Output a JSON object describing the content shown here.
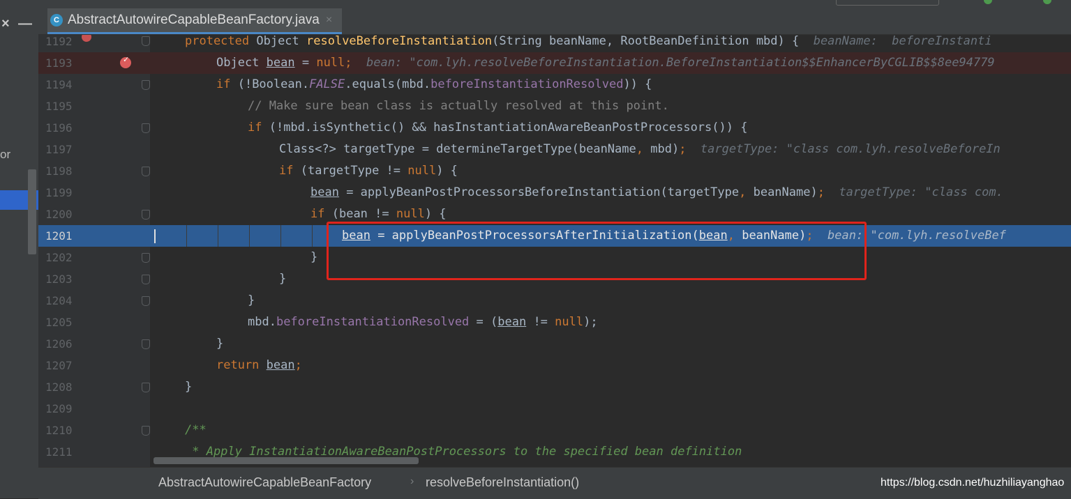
{
  "tab": {
    "icon_letter": "C",
    "filename": "AbstractAutowireCapableBeanFactory.java",
    "close": "×"
  },
  "left_panel": {
    "close_glyph": "×",
    "minimize_glyph": "—",
    "truncated_label": "or"
  },
  "breadcrumb": {
    "class_name": "AbstractAutowireCapableBeanFactory",
    "separator": "›",
    "method_name": "resolveBeforeInstantiation()"
  },
  "watermark": "https://blog.csdn.net/huzhiliayanghao",
  "editor": {
    "current_line": 1201,
    "breakpoint_line": 1193,
    "lines": [
      {
        "num": "1192"
      },
      {
        "num": "1193"
      },
      {
        "num": "1194"
      },
      {
        "num": "1195"
      },
      {
        "num": "1196"
      },
      {
        "num": "1197"
      },
      {
        "num": "1198"
      },
      {
        "num": "1199"
      },
      {
        "num": "1200"
      },
      {
        "num": "1201"
      },
      {
        "num": "1202"
      },
      {
        "num": "1203"
      },
      {
        "num": "1204"
      },
      {
        "num": "1205"
      },
      {
        "num": "1206"
      },
      {
        "num": "1207"
      },
      {
        "num": "1208"
      },
      {
        "num": "1209"
      },
      {
        "num": "1210"
      },
      {
        "num": "1211"
      }
    ],
    "t": {
      "l1192_a": "protected ",
      "l1192_b": "Object ",
      "l1192_c": "resolveBeforeInstantiation",
      "l1192_d": "(String beanName, RootBeanDefinition mbd) {  ",
      "l1192_hint": "beanName:  beforeInstanti",
      "l1193_a": "Object ",
      "l1193_b": "bean",
      "l1193_c": " = ",
      "l1193_d": "null",
      "l1193_e": ";  ",
      "l1193_hint": "bean: \"com.lyh.resolveBeforeInstantiation.BeforeInstantiation$$EnhancerByCGLIB$$8ee94779",
      "l1194_a": "if ",
      "l1194_b": "(!Boolean.",
      "l1194_c": "FALSE",
      "l1194_d": ".equals(mbd.",
      "l1194_e": "beforeInstantiationResolved",
      "l1194_f": ")) {",
      "l1195": "// Make sure bean class is actually resolved at this point.",
      "l1196_a": "if ",
      "l1196_b": "(!mbd.isSynthetic() && hasInstantiationAwareBeanPostProcessors()) {",
      "l1197_a": "Class<?> targetType = determineTargetType(beanName",
      "l1197_b": ", ",
      "l1197_c": "mbd)",
      "l1197_d": ";  ",
      "l1197_hint": "targetType: \"class com.lyh.resolveBeforeIn",
      "l1198_a": "if ",
      "l1198_b": "(targetType != ",
      "l1198_c": "null",
      "l1198_d": ") {",
      "l1199_a": "bean",
      "l1199_b": " = applyBeanPostProcessorsBeforeInstantiation(targetType",
      "l1199_c": ", ",
      "l1199_d": "beanName)",
      "l1199_e": ";  ",
      "l1199_hint": "targetType: \"class com.",
      "l1200_a": "if ",
      "l1200_b": "(",
      "l1200_c": "bean",
      "l1200_d": " != ",
      "l1200_e": "null",
      "l1200_f": ") {",
      "l1201_a": "bean",
      "l1201_b": " = applyBeanPostProcessorsAfterInitialization(",
      "l1201_c": "bean",
      "l1201_d": ", ",
      "l1201_e": "beanName)",
      "l1201_f": ";  ",
      "l1201_hint": "bean: \"com.lyh.resolveBef",
      "l1202": "}",
      "l1203": "}",
      "l1204": "}",
      "l1205_a": "mbd.",
      "l1205_b": "beforeInstantiationResolved",
      "l1205_c": " = (",
      "l1205_d": "bean",
      "l1205_e": " != ",
      "l1205_f": "null",
      "l1205_g": ");",
      "l1206": "}",
      "l1207_a": "return ",
      "l1207_b": "bean",
      "l1207_c": ";",
      "l1208": "}",
      "l1210": "/**",
      "l1211": " * Apply InstantiationAwareBeanPostProcessors to the specified bean definition"
    }
  }
}
